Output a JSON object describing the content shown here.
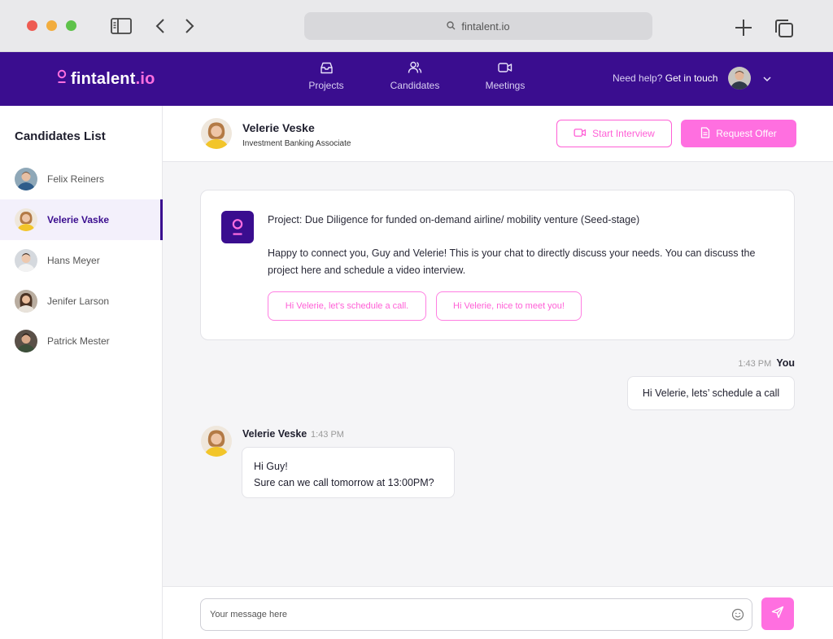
{
  "browser": {
    "url": "fintalent.io"
  },
  "header": {
    "logo_main": "fintalent",
    "logo_suffix": ".io",
    "nav": [
      {
        "label": "Projects",
        "icon": "inbox-icon"
      },
      {
        "label": "Candidates",
        "icon": "users-icon"
      },
      {
        "label": "Meetings",
        "icon": "video-icon"
      }
    ],
    "help_prefix": "Need help?",
    "help_link": "Get in touch"
  },
  "sidebar": {
    "title": "Candidates List",
    "items": [
      {
        "name": "Felix Reiners",
        "active": false
      },
      {
        "name": "Velerie Vaske",
        "active": true
      },
      {
        "name": "Hans Meyer",
        "active": false
      },
      {
        "name": "Jenifer Larson",
        "active": false
      },
      {
        "name": "Patrick Mester",
        "active": false
      }
    ]
  },
  "chat_header": {
    "name": "Velerie Veske",
    "role": "Investment Banking Associate",
    "start_interview_label": "Start Interview",
    "request_offer_label": "Request Offer"
  },
  "project_card": {
    "title": "Project: Due Diligence for funded on-demand airline/ mobility venture (Seed-stage)",
    "description": "Happy to connect you, Guy and Velerie! This is your chat to directly discuss your needs. You can discuss the project here and schedule a video interview.",
    "quick_replies": [
      "Hi Velerie, let’s schedule a call.",
      "Hi Velerie, nice to meet you!"
    ]
  },
  "messages": {
    "outgoing": {
      "time": "1:43 PM",
      "sender": "You",
      "text": "Hi Velerie, lets’ schedule a call"
    },
    "incoming": {
      "sender": "Velerie Veske",
      "time": "1:43 PM",
      "line1": "Hi Guy!",
      "line2": "Sure can we call tomorrow at 13:00PM?"
    }
  },
  "composer": {
    "placeholder": "Your message here"
  },
  "colors": {
    "brand_purple": "#3a0d8f",
    "accent_pink": "#ff6fe0"
  }
}
